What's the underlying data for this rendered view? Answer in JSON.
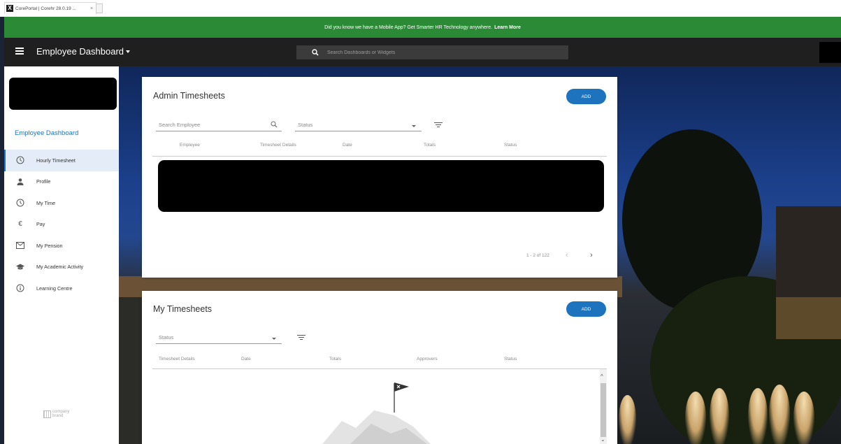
{
  "browser": {
    "tab_title": "CorePortal | Corehr 28.0.19 ...",
    "tab_close": "×",
    "favicon": "X"
  },
  "banner": {
    "text": "Did you know we have a Mobile App? Get Smarter HR Technology anywhere.",
    "link": "Learn More",
    "color": "#2b8a36"
  },
  "appbar": {
    "title": "Employee Dashboard",
    "search_placeholder": "Search Dashboards or Widgets"
  },
  "sidebar": {
    "title": "Employee Dashboard",
    "items": [
      {
        "label": "Hourly Timesheet",
        "icon": "clock-icon",
        "active": true
      },
      {
        "label": "Profile",
        "icon": "person-icon",
        "active": false
      },
      {
        "label": "My Time",
        "icon": "clock-icon",
        "active": false
      },
      {
        "label": "Pay",
        "icon": "euro-icon",
        "active": false
      },
      {
        "label": "My Pension",
        "icon": "mail-icon",
        "active": false
      },
      {
        "label": "My Academic Activity",
        "icon": "graduation-cap-icon",
        "active": false
      },
      {
        "label": "Learning Centre",
        "icon": "info-icon",
        "active": false
      }
    ],
    "brand": {
      "line1": "company",
      "line2": "brand"
    }
  },
  "admin_timesheets": {
    "title": "Admin Timesheets",
    "add_label": "ADD",
    "search_placeholder": "Search Employee",
    "status_label": "Status",
    "columns": [
      "Employee",
      "Timesheet Details",
      "Date",
      "Totals",
      "Status"
    ],
    "pagination": "1 - 2 of 122"
  },
  "my_timesheets": {
    "title": "My Timesheets",
    "add_label": "ADD",
    "status_label": "Status",
    "columns": [
      "Timesheet Details",
      "Date",
      "Totals",
      "Approvers",
      "Status"
    ]
  },
  "colors": {
    "accent": "#1e73be",
    "appbar": "#1f1f1f"
  }
}
